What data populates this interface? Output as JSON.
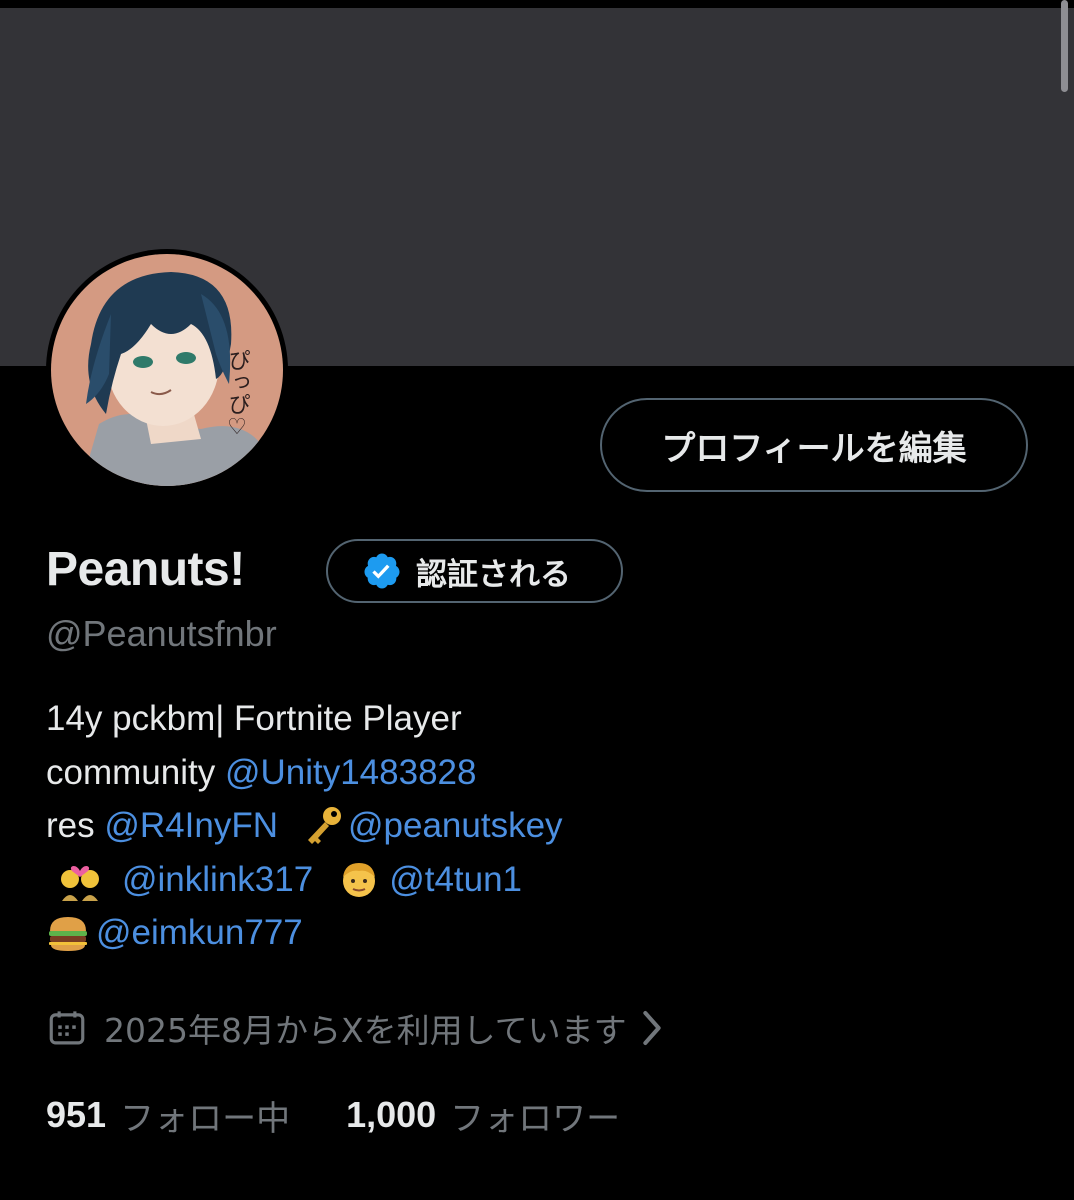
{
  "profile": {
    "edit_button": "プロフィールを編集",
    "display_name": "Peanuts!",
    "verified_label": "認証される",
    "handle": "@Peanutsfnbr",
    "avatar_text": "ぴっぴ♡",
    "bio": {
      "line1": "14y pckbm| Fortnite Player",
      "line2_prefix": "community ",
      "line2_mention": "@Unity1483828",
      "line3_prefix": "res ",
      "line3_mention1": "@R4InyFN",
      "line3_mention2": "@peanutskey",
      "line4_mention1": "@inklink317",
      "line4_mention2": "@t4tun1",
      "line5_mention": "@eimkun777"
    },
    "emoji": [
      "key",
      "couple-with-heart",
      "man",
      "hamburger"
    ],
    "joined": "2025年8月からXを利用しています",
    "following_count": "951",
    "following_label": "フォロー中",
    "followers_count": "1,000",
    "followers_label": "フォロワー"
  },
  "colors": {
    "background": "#000000",
    "banner": "#333337",
    "accent": "#4c8fe0",
    "muted": "#71767b",
    "verified_badge": "#1d9bf0"
  }
}
